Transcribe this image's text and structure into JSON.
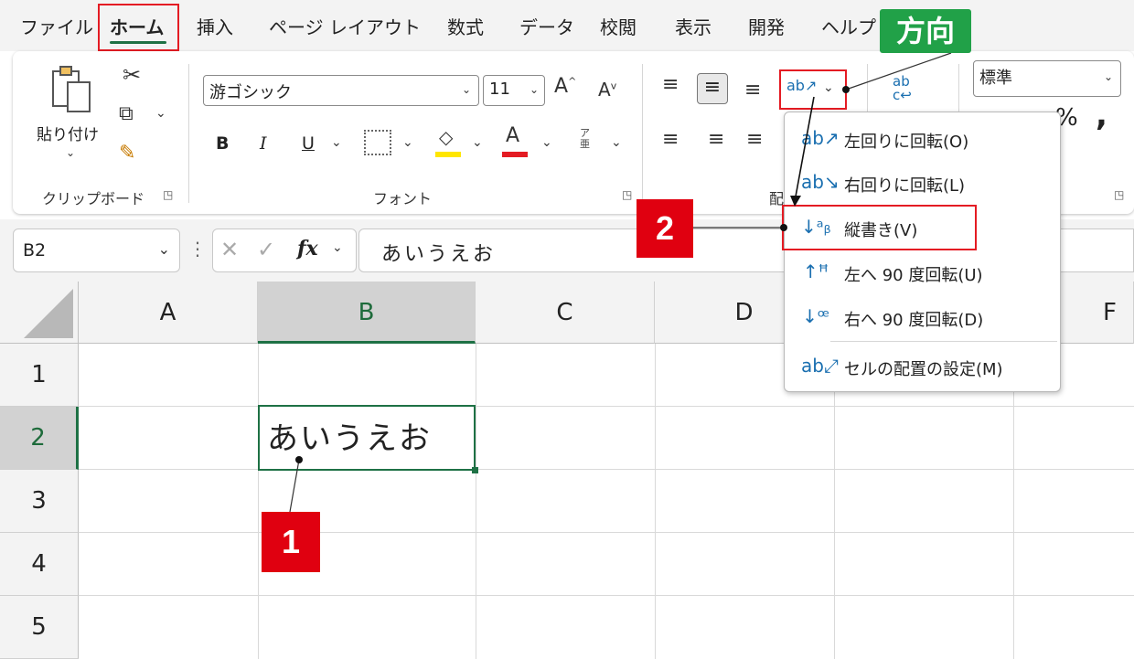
{
  "ribbon": {
    "tabs": [
      "ファイル",
      "ホーム",
      "挿入",
      "ページ レイアウト",
      "数式",
      "データ",
      "校閲",
      "表示",
      "開発",
      "ヘルプ"
    ],
    "active_tab": "ホーム",
    "clipboard": {
      "paste_label": "貼り付け",
      "group_label": "クリップボード"
    },
    "font": {
      "font_name": "游ゴシック",
      "font_size": "11",
      "bold": "B",
      "italic": "I",
      "underline": "U",
      "phonetic": "ア亜",
      "group_label": "フォント"
    },
    "alignment": {
      "group_label_partial": "配"
    },
    "number": {
      "format": "標準",
      "percent": "%",
      "comma": ","
    }
  },
  "formula_bar": {
    "name_box": "B2",
    "fx": "fx",
    "content": "あいうえお"
  },
  "grid": {
    "columns": [
      "A",
      "B",
      "C",
      "D",
      "E",
      "F"
    ],
    "rows": [
      "1",
      "2",
      "3",
      "4",
      "5"
    ],
    "selected_col": "B",
    "selected_row": "2",
    "cell_b2": "あいうえお"
  },
  "orientation_menu": {
    "items": [
      {
        "label": "左回りに回転(O)",
        "icon": "rotate-ccw-icon"
      },
      {
        "label": "右回りに回転(L)",
        "icon": "rotate-cw-icon"
      },
      {
        "label": "縦書き(V)",
        "icon": "vertical-text-icon"
      },
      {
        "label": "左へ 90 度回転(U)",
        "icon": "rotate-up-icon"
      },
      {
        "label": "右へ 90 度回転(D)",
        "icon": "rotate-down-icon"
      },
      {
        "label": "セルの配置の設定(M)",
        "icon": "format-alignment-icon"
      }
    ]
  },
  "callouts": {
    "direction": "方向",
    "step1": "1",
    "step2": "2"
  },
  "colors": {
    "excel_green": "#1e7145",
    "highlight_red": "#e41b23",
    "callout_green": "#21a148",
    "callout_red": "#e00010"
  }
}
